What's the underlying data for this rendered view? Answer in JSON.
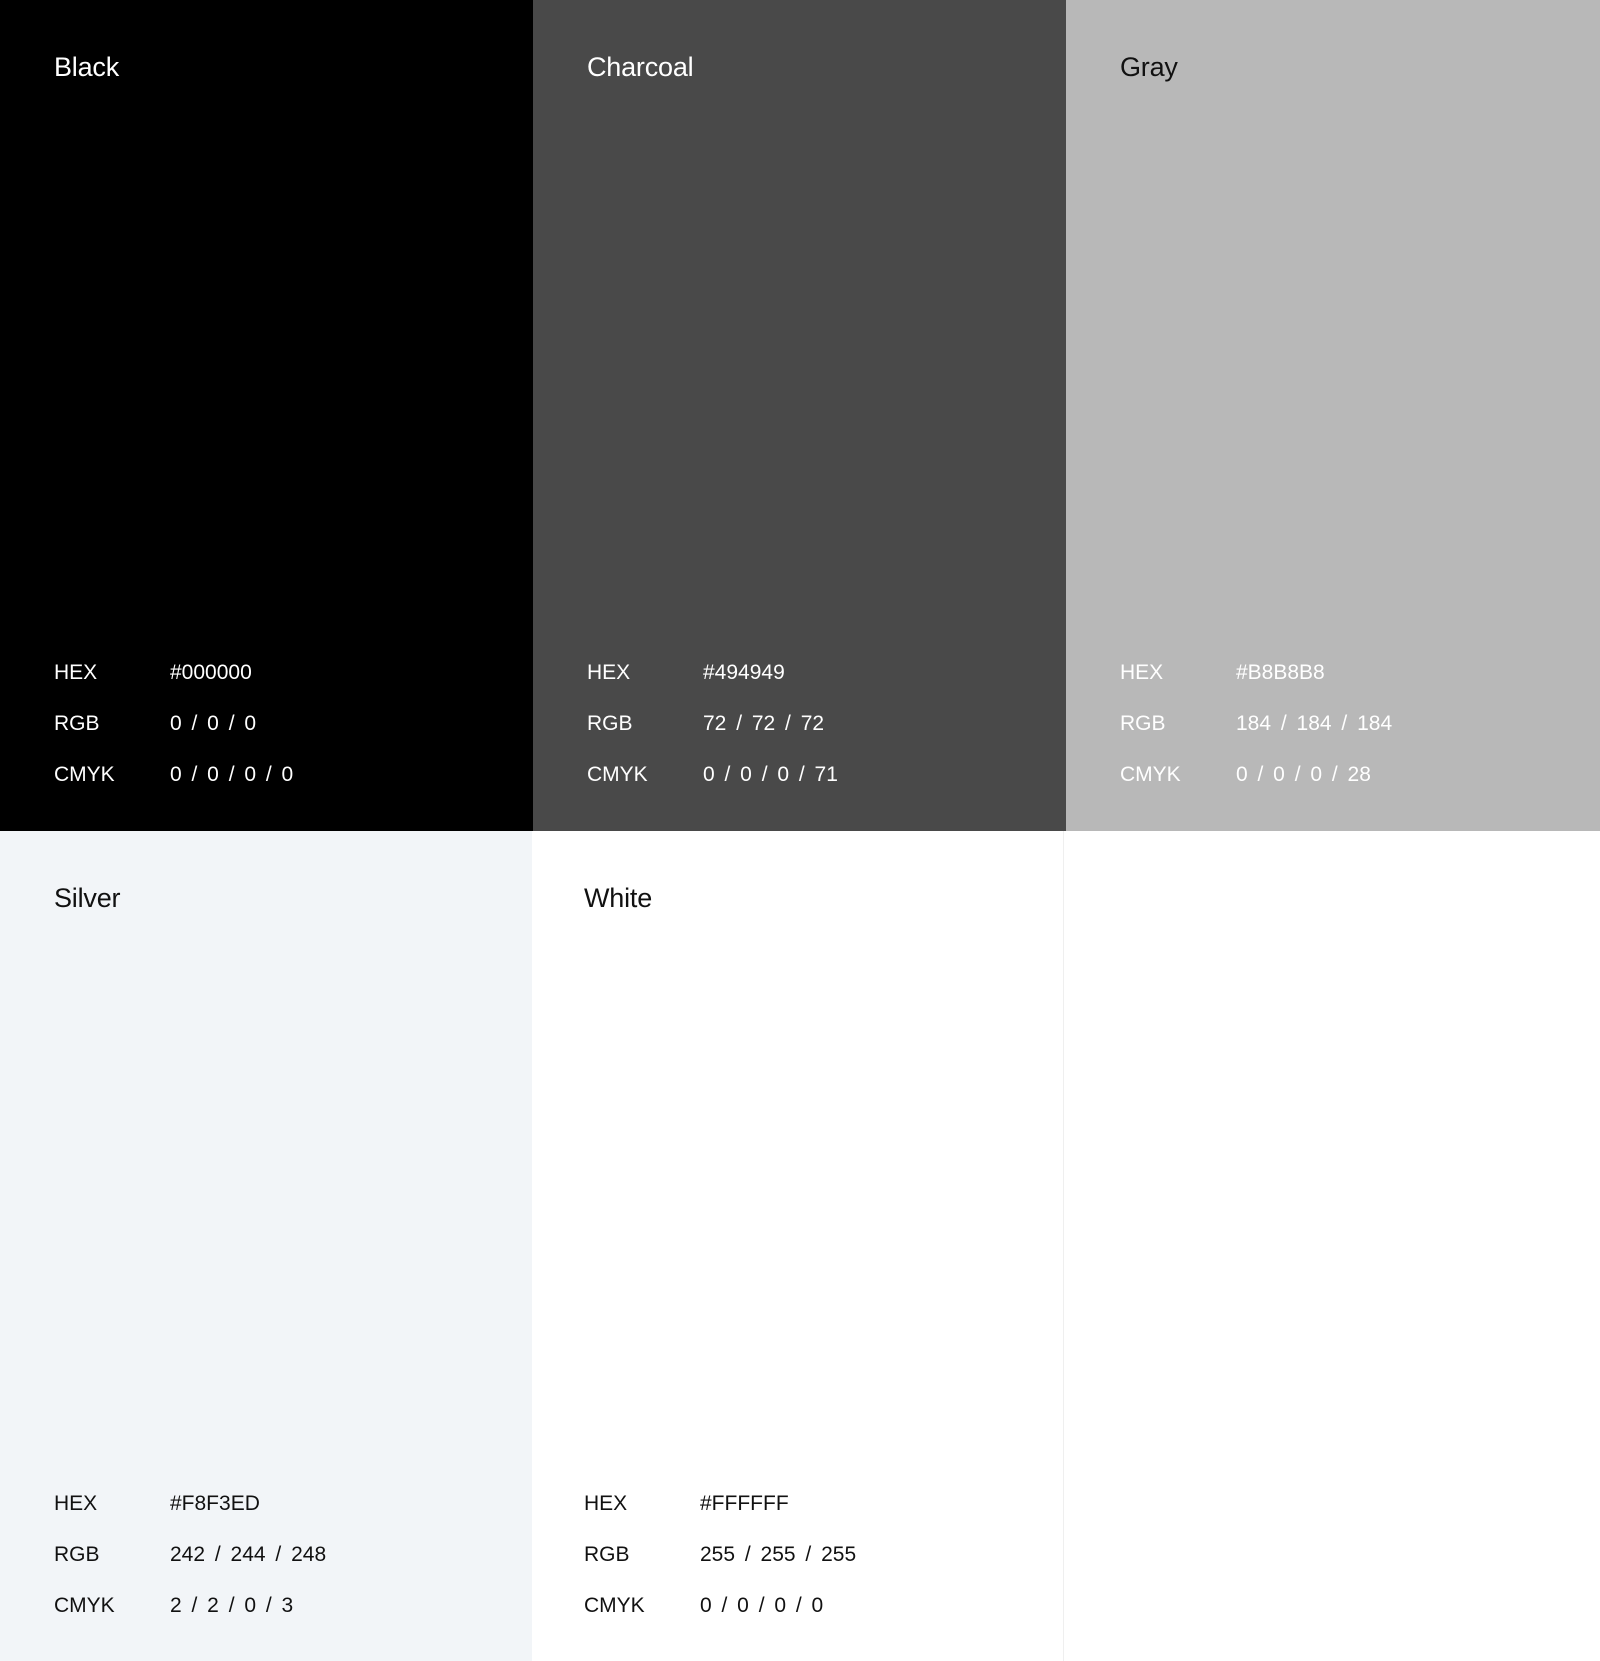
{
  "swatches": [
    {
      "name": "Black",
      "background": "#000000",
      "text_color": "#FFFFFF",
      "specs": [
        {
          "label": "HEX",
          "value": "#000000"
        },
        {
          "label": "RGB",
          "value": "0 / 0 / 0"
        },
        {
          "label": "CMYK",
          "value": "0 / 0 / 0 / 0"
        }
      ]
    },
    {
      "name": "Charcoal",
      "background": "#494949",
      "text_color": "#FFFFFF",
      "specs": [
        {
          "label": "HEX",
          "value": "#494949"
        },
        {
          "label": "RGB",
          "value": "72 / 72 / 72"
        },
        {
          "label": "CMYK",
          "value": "0 / 0 / 0 / 71"
        }
      ]
    },
    {
      "name": "Gray",
      "background": "#B8B8B8",
      "text_color": "#FFFFFF",
      "name_color": "#111111",
      "specs": [
        {
          "label": "HEX",
          "value": "#B8B8B8"
        },
        {
          "label": "RGB",
          "value": "184 / 184 / 184"
        },
        {
          "label": "CMYK",
          "value": "0 / 0 / 0 / 28"
        }
      ]
    },
    {
      "name": "Silver",
      "background": "#F2F5F8",
      "text_color": "#111111",
      "specs": [
        {
          "label": "HEX",
          "value": "#F8F3ED"
        },
        {
          "label": "RGB",
          "value": "242 / 244 / 248"
        },
        {
          "label": "CMYK",
          "value": "2 / 2 / 0 / 3"
        }
      ]
    },
    {
      "name": "White",
      "background": "#FFFFFF",
      "text_color": "#111111",
      "specs": [
        {
          "label": "HEX",
          "value": "#FFFFFF"
        },
        {
          "label": "RGB",
          "value": "255 / 255 / 255"
        },
        {
          "label": "CMYK",
          "value": "0 / 0 / 0 / 0"
        }
      ]
    }
  ]
}
